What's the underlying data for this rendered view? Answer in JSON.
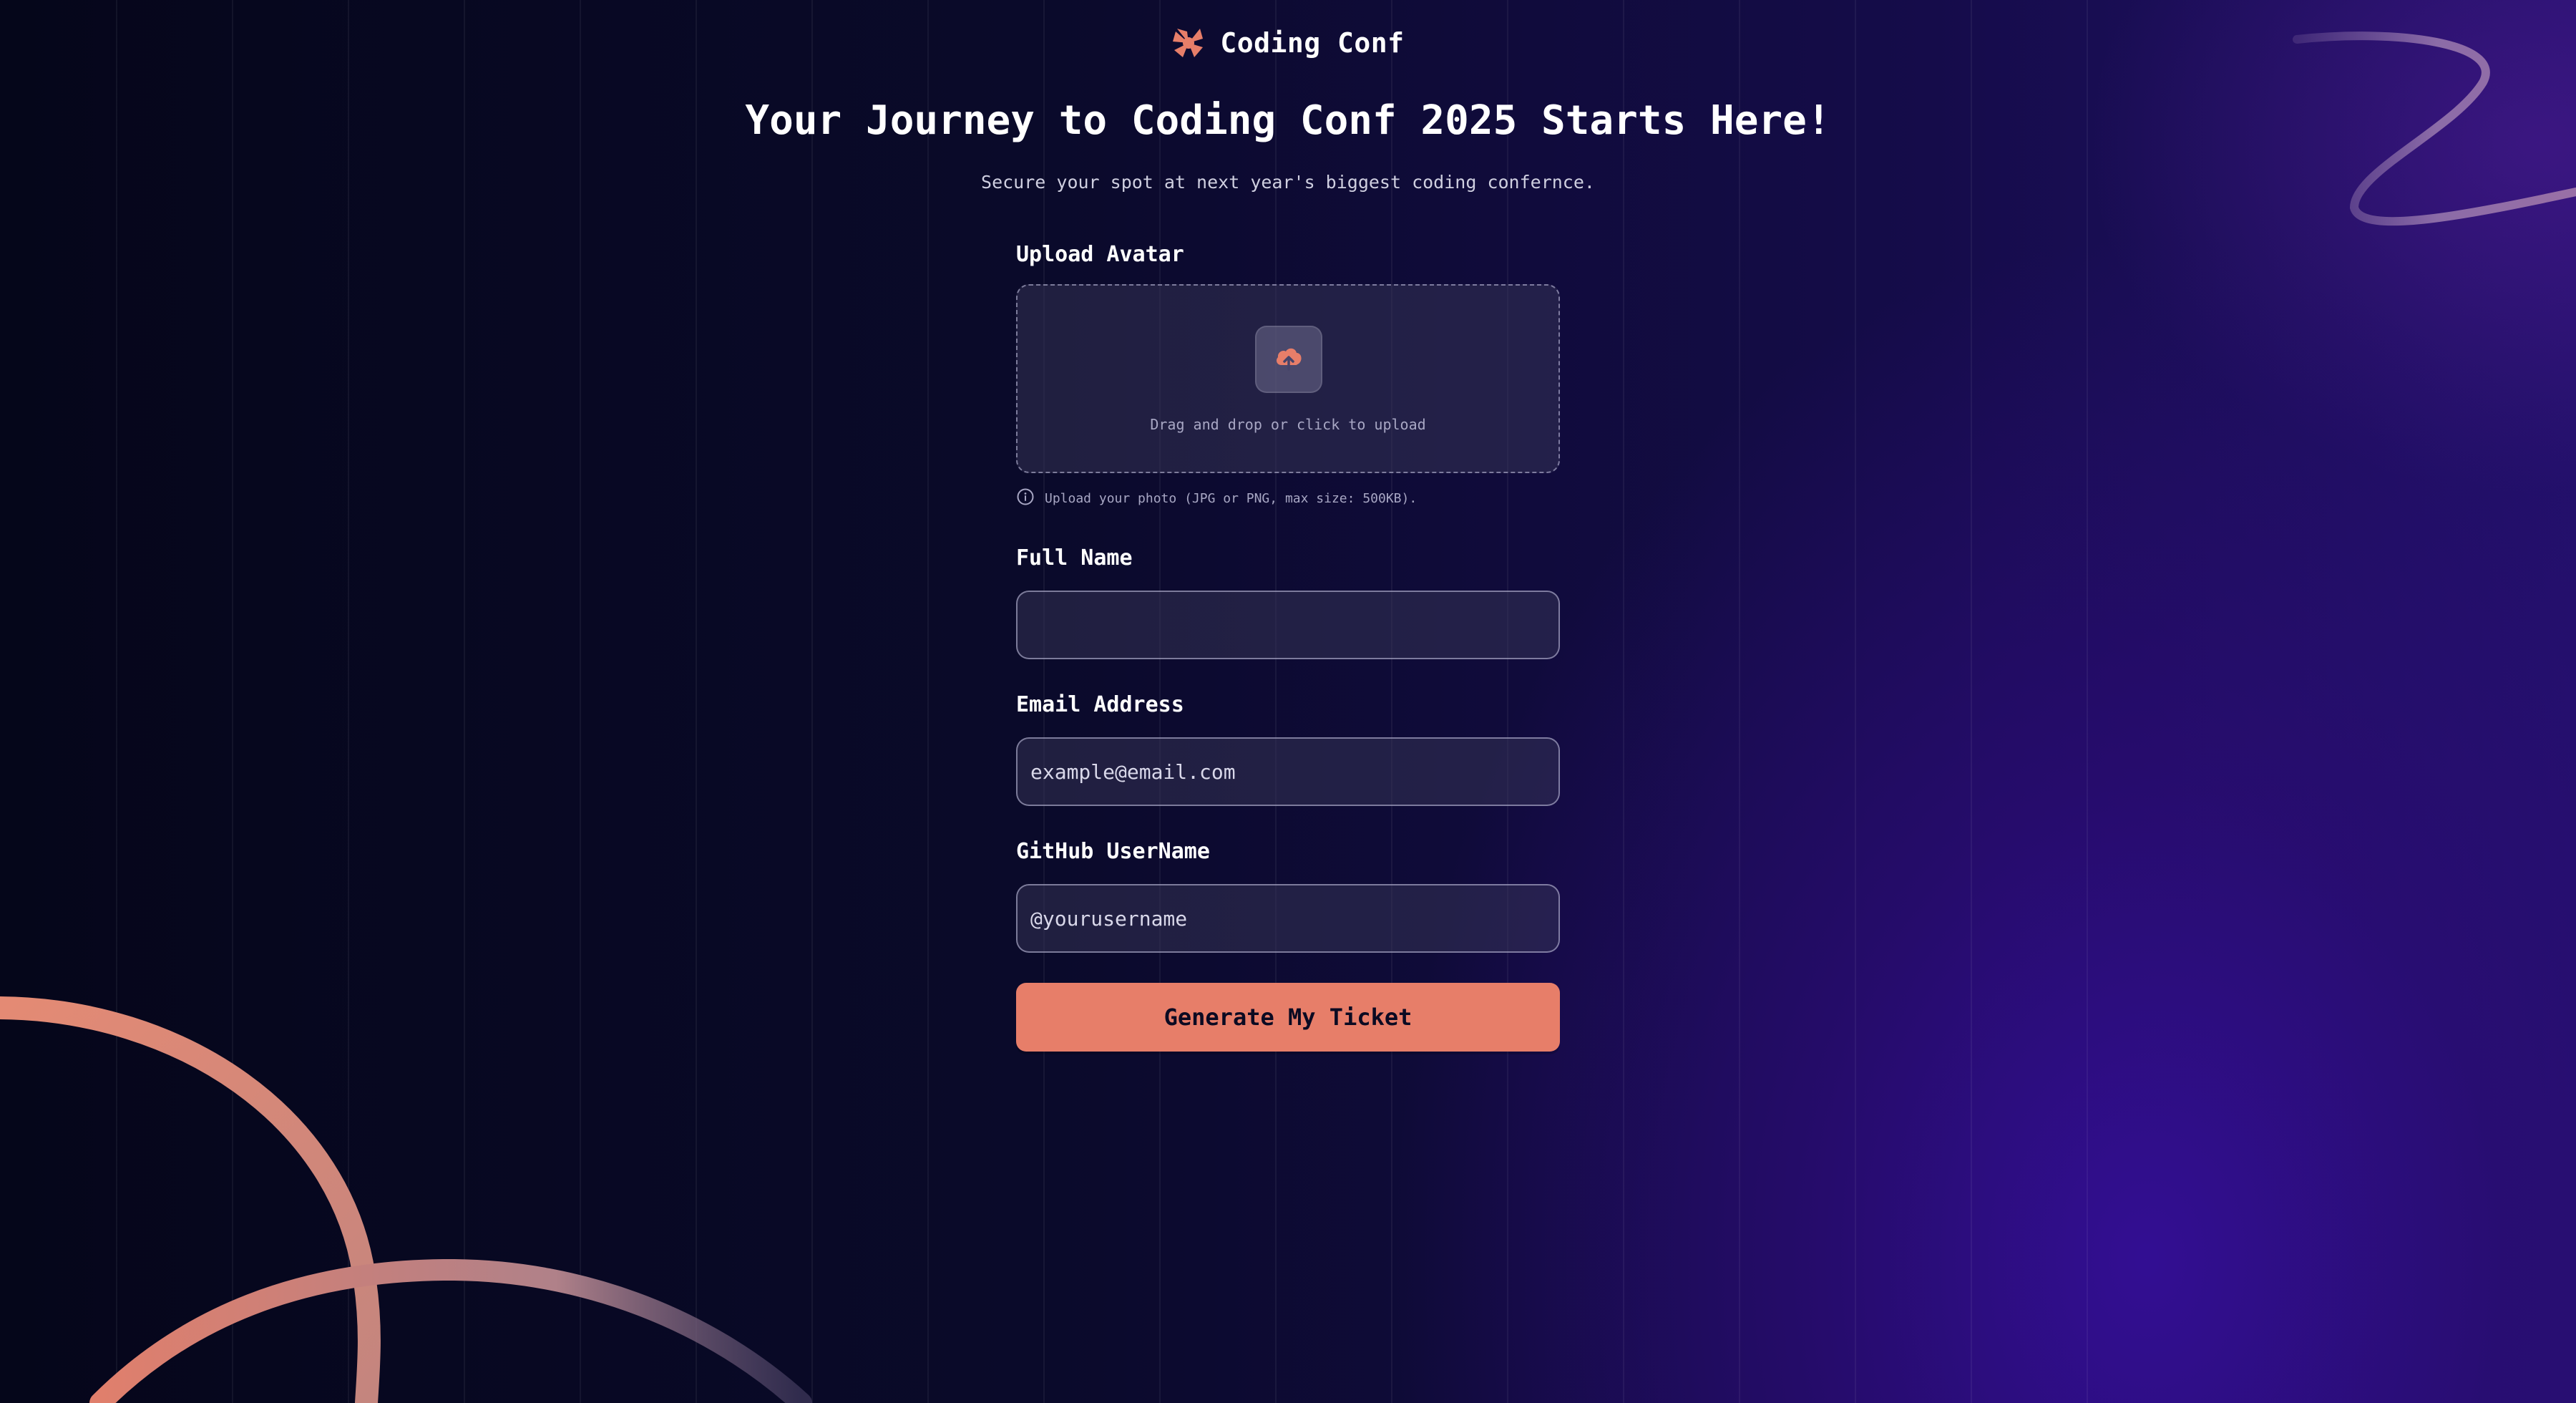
{
  "brand": {
    "name": "Coding Conf"
  },
  "hero": {
    "title": "Your Journey to Coding Conf 2025 Starts Here!",
    "subtitle": "Secure your spot at next year's biggest coding confernce."
  },
  "form": {
    "avatar": {
      "label": "Upload Avatar",
      "dropzone_text": "Drag and drop or click to upload",
      "hint": "Upload your photo (JPG or PNG, max size: 500KB)."
    },
    "full_name": {
      "label": "Full Name",
      "value": "",
      "placeholder": ""
    },
    "email": {
      "label": "Email Address",
      "value": "",
      "placeholder": "example@email.com"
    },
    "github": {
      "label": "GitHub UserName",
      "value": "",
      "placeholder": "@yourusername"
    },
    "submit_label": "Generate My Ticket"
  },
  "colors": {
    "accent": "#e77e69",
    "background": "#0b0924",
    "background_glow": "#2c0c78"
  },
  "icons": {
    "logo": "coding-conf-logo-icon",
    "upload": "cloud-upload-icon",
    "hint": "info-icon"
  }
}
